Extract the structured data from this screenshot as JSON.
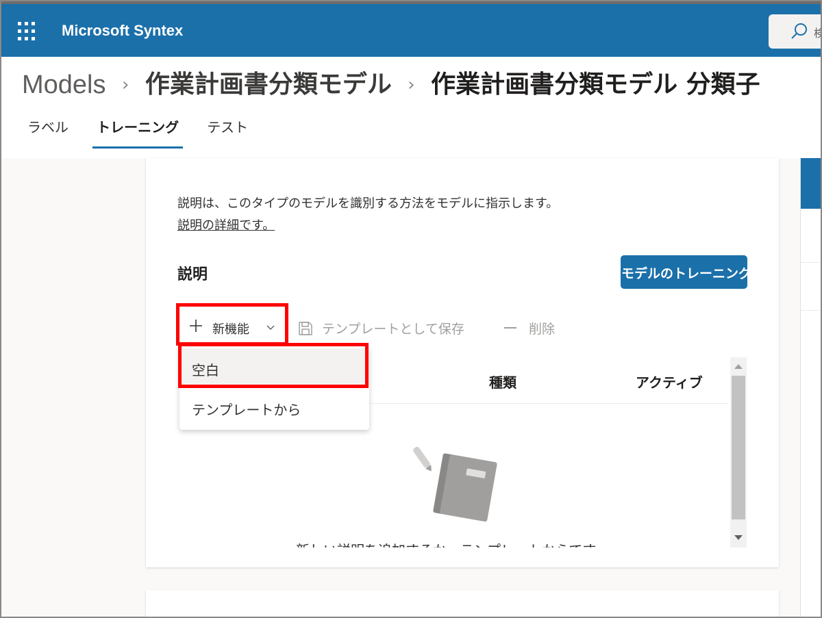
{
  "app": {
    "name": "Microsoft Syntex"
  },
  "search": {
    "placeholder_visible": "検"
  },
  "breadcrumb": {
    "items": [
      "Models",
      "作業計画書分類モデル",
      "作業計画書分類モデル 分類子"
    ],
    "separator": "›"
  },
  "tabs": [
    {
      "label": "ラベル",
      "active": false
    },
    {
      "label": "トレーニング",
      "active": true
    },
    {
      "label": "テスト",
      "active": false
    }
  ],
  "main": {
    "intro": "説明は、このタイプのモデルを識別する方法をモデルに指示します。",
    "intro_link": "説明の詳細です。",
    "section_title": "説明",
    "train_button": "モデルのトレーニング"
  },
  "commands": {
    "new_label": "新機能",
    "save_template_label": "テンプレートとして保存",
    "delete_label": "削除"
  },
  "menu": {
    "items": [
      {
        "label": "空白",
        "hovered": true
      },
      {
        "label": "テンプレートから",
        "hovered": false
      }
    ]
  },
  "table": {
    "columns": [
      "種類",
      "アクティブ"
    ],
    "empty_text": "新しい説明を追加するか、テンプレートからです。"
  },
  "colors": {
    "brand": "#1b70aa",
    "highlight": "#ff0000"
  },
  "icons": {
    "waffle": "waffle-icon",
    "search": "search-icon",
    "plus": "plus-icon",
    "save": "save-icon",
    "delete": "minus-icon",
    "chevron": "chevron-down-icon",
    "empty": "notebook-icon"
  }
}
